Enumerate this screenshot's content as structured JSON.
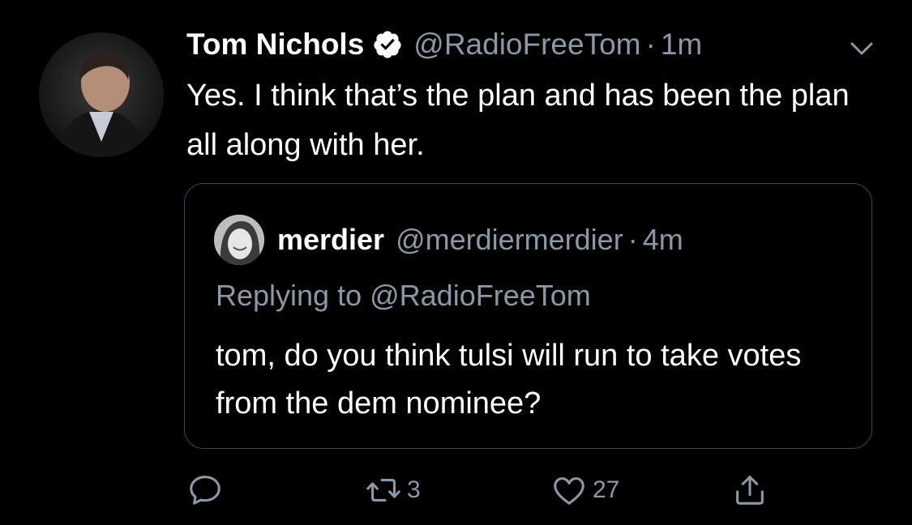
{
  "tweet": {
    "author_name": "Tom Nichols",
    "handle": "@RadioFreeTom",
    "separator": "·",
    "time": "1m",
    "text": "Yes. I think that’s the plan and has been the plan all along with her."
  },
  "quoted_tweet": {
    "author_name": "merdier",
    "handle": "@merdiermerdier",
    "separator": "·",
    "time": "4m",
    "replying_to": "Replying to @RadioFreeTom",
    "text": "tom, do you think tulsi will run to take votes from the dem nominee?"
  },
  "actions": {
    "reply_icon": "comment-bubble-icon",
    "retweet_icon": "retweet-icon",
    "retweet_count": "3",
    "like_icon": "heart-icon",
    "like_count": "27",
    "share_icon": "share-icon"
  },
  "colors": {
    "background": "#000000",
    "primary_text": "#ffffff",
    "secondary_text": "#8b98a5",
    "border": "#3d4650"
  }
}
